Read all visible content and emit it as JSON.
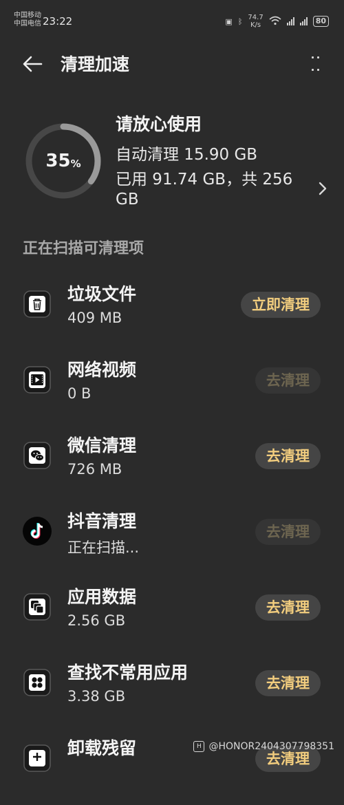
{
  "status_bar": {
    "carrier_1": "中国移动",
    "carrier_2": "中国电信",
    "time": "23:22",
    "net_speed": "74.7",
    "net_unit": "K/s",
    "battery": "80"
  },
  "header": {
    "title": "清理加速"
  },
  "summary": {
    "percent": "35",
    "percent_sign": "%",
    "used_fraction": 0.35,
    "title": "请放心使用",
    "auto_clean": "自动清理 15.90 GB",
    "used_line": "已用 91.74 GB，共 256",
    "used_line_wrap": "GB"
  },
  "section_title": "正在扫描可清理项",
  "items": [
    {
      "icon": "trash-icon",
      "name": "垃圾文件",
      "size": "409 MB",
      "button": "立即清理",
      "enabled": true
    },
    {
      "icon": "video-icon",
      "name": "网络视频",
      "size": "0 B",
      "button": "去清理",
      "enabled": false
    },
    {
      "icon": "wechat-icon",
      "name": "微信清理",
      "size": "726 MB",
      "button": "去清理",
      "enabled": true
    },
    {
      "icon": "tiktok-icon",
      "name": "抖音清理",
      "size": "正在扫描...",
      "button": "去清理",
      "enabled": false
    },
    {
      "icon": "app-data-icon",
      "name": "应用数据",
      "size": "2.56 GB",
      "button": "去清理",
      "enabled": true
    },
    {
      "icon": "apps-grid-icon",
      "name": "查找不常用应用",
      "size": "3.38 GB",
      "button": "去清理",
      "enabled": true
    },
    {
      "icon": "uninstall-icon",
      "name": "卸载残留",
      "size": "",
      "button": "去清理",
      "enabled": true
    }
  ],
  "watermark": {
    "logo": "H",
    "text": "@HONOR2404307798351"
  },
  "colors": {
    "background": "#2b2b2b",
    "accent": "#f2cd7e",
    "ring_track": "#474747",
    "ring_fill": "#9a9a9a"
  }
}
